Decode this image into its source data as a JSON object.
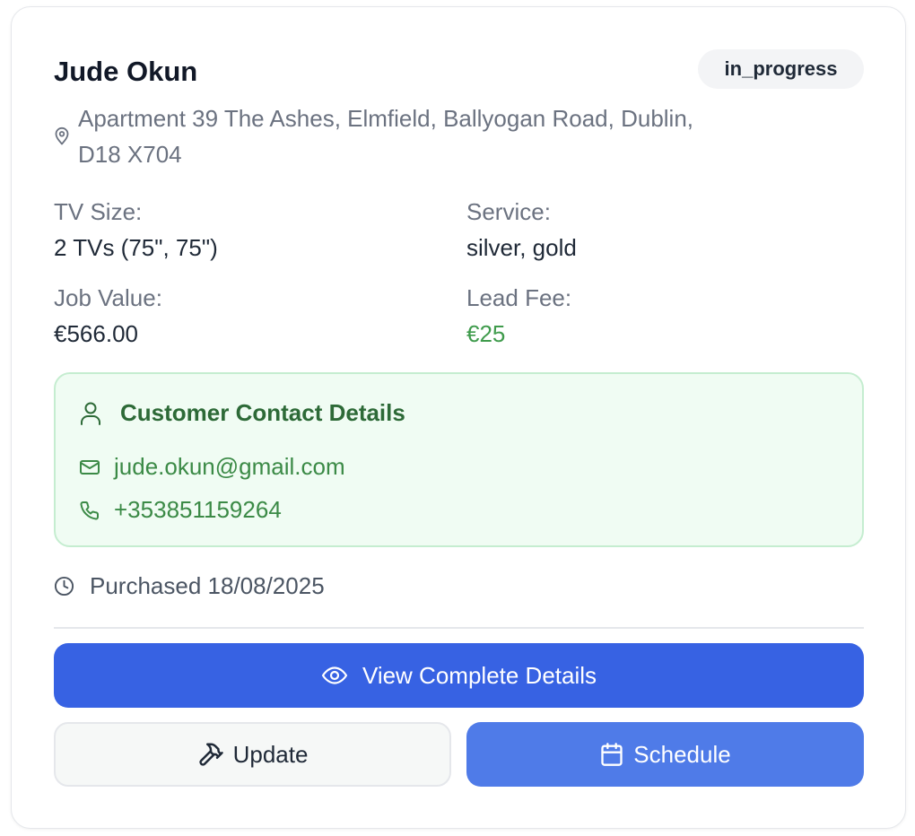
{
  "lead": {
    "customer_name": "Jude Okun",
    "status": "in_progress",
    "address": "Apartment 39 The Ashes, Elmfield, Ballyogan Road, Dublin, D18 X704",
    "tv_size_label": "TV Size:",
    "tv_size_value": "2 TVs (75\", 75\")",
    "service_label": "Service:",
    "service_value": "silver, gold",
    "job_value_label": "Job Value:",
    "job_value": "€566.00",
    "lead_fee_label": "Lead Fee:",
    "lead_fee": "€25"
  },
  "contact": {
    "title": "Customer Contact Details",
    "email": "jude.okun@gmail.com",
    "phone": "+353851159264",
    "icons": [
      "user-icon",
      "mail-icon",
      "phone-icon"
    ]
  },
  "purchased": {
    "text": "Purchased 18/08/2025",
    "icon": "clock-icon"
  },
  "actions": {
    "view_label": "View Complete Details",
    "view_icon": "eye-icon",
    "update_label": "Update",
    "update_icon": "hammer-icon",
    "schedule_label": "Schedule",
    "schedule_icon": "calendar-icon"
  },
  "colors": {
    "primary": "#3762e3",
    "schedule": "#4f7be8",
    "fee_green": "#3f9b4c",
    "contact_bg": "#f0fcf3",
    "contact_border": "#c5edd0"
  }
}
